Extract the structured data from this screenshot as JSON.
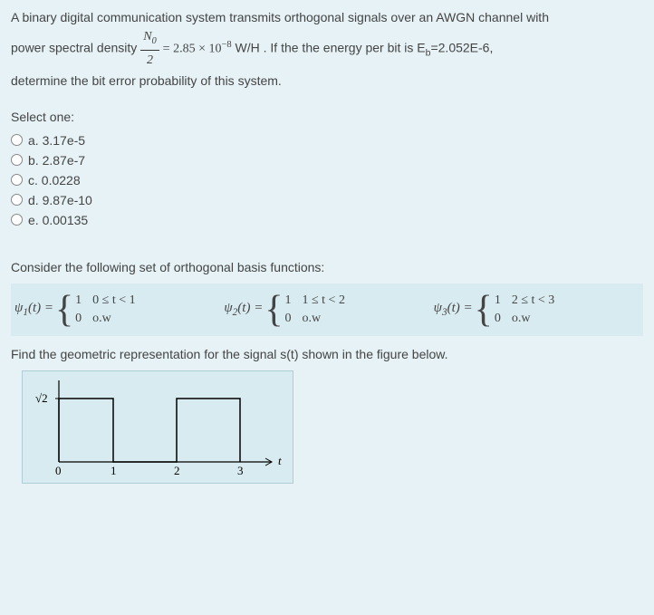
{
  "q1": {
    "text_a": "A binary digital communication system transmits orthogonal signals over an AWGN channel with",
    "text_b": "power spectral density",
    "frac_num": "N",
    "frac_num_sub": "0",
    "frac_den": "2",
    "eq_part": " = 2.85 × 10",
    "eq_exp": "−8",
    "eq_unit": " W/H . If the the energy per bit is E",
    "eb_sub": "b",
    "eb_val": "=2.052E-6,",
    "text_c": "determine the bit error probability of this system.",
    "select_label": "Select one:",
    "options": [
      {
        "key": "a",
        "label": "a. 3.17e-5"
      },
      {
        "key": "b",
        "label": "b. 2.87e-7"
      },
      {
        "key": "c",
        "label": "c. 0.0228"
      },
      {
        "key": "d",
        "label": "d. 9.87e-10"
      },
      {
        "key": "e",
        "label": "e. 0.00135"
      }
    ]
  },
  "q2": {
    "intro": "Consider the following set of orthogonal basis functions:",
    "psi": [
      {
        "name": "ψ",
        "idx": "1",
        "arg": "(t) = ",
        "v1": "1",
        "c1": "0 ≤ t < 1",
        "v2": "0",
        "c2": "o.w"
      },
      {
        "name": "ψ",
        "idx": "2",
        "arg": "(t) = ",
        "v1": "1",
        "c1": "1 ≤ t < 2",
        "v2": "0",
        "c2": "o.w"
      },
      {
        "name": "ψ",
        "idx": "3",
        "arg": "(t) = ",
        "v1": "1",
        "c1": "2 ≤ t < 3",
        "v2": "0",
        "c2": "o.w"
      }
    ],
    "find_text": "Find the geometric representation for the signal s(t) shown in the figure below.",
    "figure": {
      "ylevel_label": "√2",
      "xticks": [
        "0",
        "1",
        "2",
        "3"
      ],
      "taxis_label": "t"
    }
  },
  "chart_data": {
    "type": "line",
    "title": "",
    "xlabel": "t",
    "ylabel": "",
    "xlim": [
      0,
      3.3
    ],
    "ylim": [
      0,
      1.6
    ],
    "ytick_labels": [
      "√2"
    ],
    "ytick_values": [
      1.414
    ],
    "xticks": [
      0,
      1,
      2,
      3
    ],
    "series": [
      {
        "name": "s(t)",
        "x": [
          0,
          0,
          1,
          1,
          2,
          2,
          3,
          3
        ],
        "y": [
          0,
          1.414,
          1.414,
          0,
          0,
          1.414,
          1.414,
          0
        ]
      }
    ]
  }
}
